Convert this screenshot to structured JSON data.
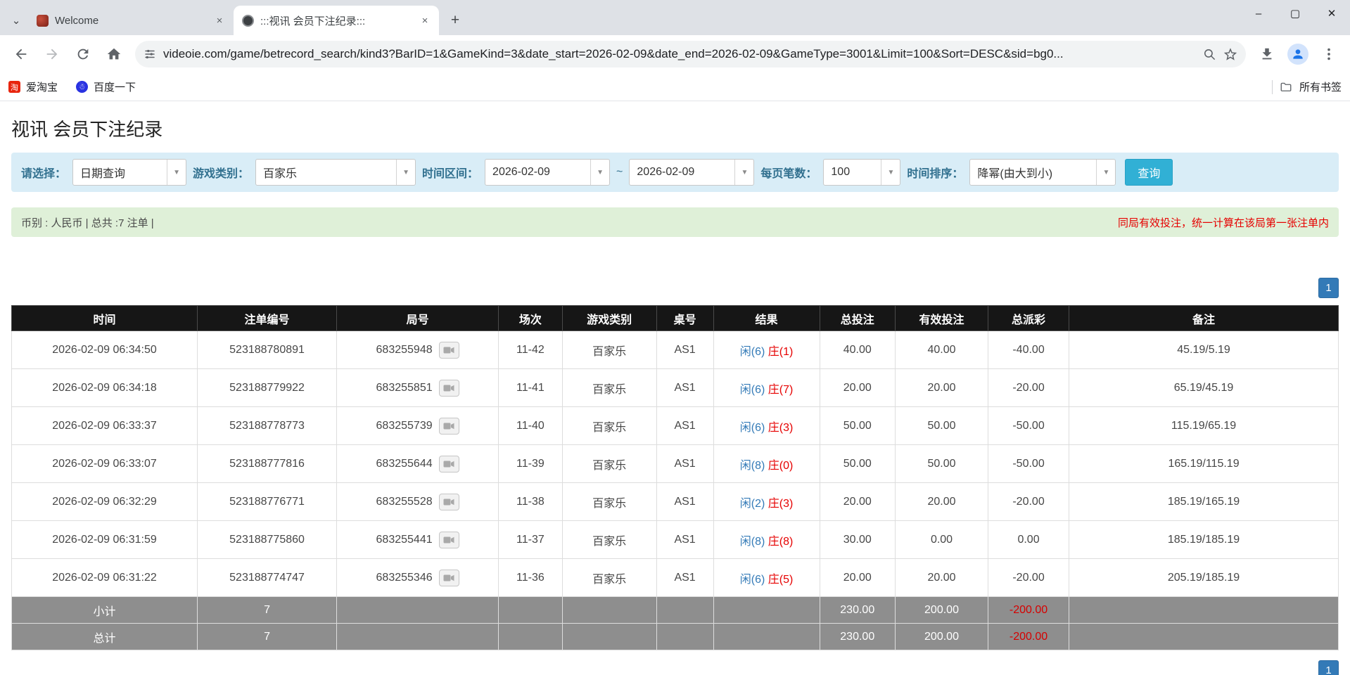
{
  "browser": {
    "tabs": [
      {
        "title": "Welcome"
      },
      {
        "title": ":::视讯 会员下注纪录:::"
      }
    ],
    "url": "videoie.com/game/betrecord_search/kind3?BarID=1&GameKind=3&date_start=2026-02-09&date_end=2026-02-09&GameType=3001&Limit=100&Sort=DESC&sid=bg0...",
    "bookmarks": [
      {
        "label": "爱淘宝"
      },
      {
        "label": "百度一下"
      }
    ],
    "all_bookmarks_label": "所有书签"
  },
  "page": {
    "title": "视讯 会员下注纪录",
    "filters": {
      "select_label": "请选择：",
      "select_value": "日期查询",
      "game_kind_label": "游戏类别：",
      "game_kind_value": "百家乐",
      "date_range_label": "时间区间：",
      "date_start": "2026-02-09",
      "tilde": "~",
      "date_end": "2026-02-09",
      "page_size_label": "每页笔数：",
      "page_size_value": "100",
      "sort_label": "时间排序：",
      "sort_value": "降幂(由大到小)",
      "search_button": "查询"
    },
    "info_bar": {
      "left": "币别 : 人民币 | 总共 :7 注单 |",
      "right": "同局有效投注，统一计算在该局第一张注单内"
    },
    "pagination": {
      "page": "1"
    },
    "table": {
      "headers": [
        "时间",
        "注单编号",
        "局号",
        "场次",
        "游戏类别",
        "桌号",
        "结果",
        "总投注",
        "有效投注",
        "总派彩",
        "备注"
      ],
      "rows": [
        {
          "time": "2026-02-09 06:34:50",
          "bet_id": "523188780891",
          "round": "683255948",
          "session": "11-42",
          "game": "百家乐",
          "table": "AS1",
          "player": "闲(6)",
          "banker": "庄(1)",
          "total": "40.00",
          "valid": "40.00",
          "payout": "-40.00",
          "note": "45.19/5.19"
        },
        {
          "time": "2026-02-09 06:34:18",
          "bet_id": "523188779922",
          "round": "683255851",
          "session": "11-41",
          "game": "百家乐",
          "table": "AS1",
          "player": "闲(6)",
          "banker": "庄(7)",
          "total": "20.00",
          "valid": "20.00",
          "payout": "-20.00",
          "note": "65.19/45.19"
        },
        {
          "time": "2026-02-09 06:33:37",
          "bet_id": "523188778773",
          "round": "683255739",
          "session": "11-40",
          "game": "百家乐",
          "table": "AS1",
          "player": "闲(6)",
          "banker": "庄(3)",
          "total": "50.00",
          "valid": "50.00",
          "payout": "-50.00",
          "note": "115.19/65.19"
        },
        {
          "time": "2026-02-09 06:33:07",
          "bet_id": "523188777816",
          "round": "683255644",
          "session": "11-39",
          "game": "百家乐",
          "table": "AS1",
          "player": "闲(8)",
          "banker": "庄(0)",
          "total": "50.00",
          "valid": "50.00",
          "payout": "-50.00",
          "note": "165.19/115.19"
        },
        {
          "time": "2026-02-09 06:32:29",
          "bet_id": "523188776771",
          "round": "683255528",
          "session": "11-38",
          "game": "百家乐",
          "table": "AS1",
          "player": "闲(2)",
          "banker": "庄(3)",
          "total": "20.00",
          "valid": "20.00",
          "payout": "-20.00",
          "note": "185.19/165.19"
        },
        {
          "time": "2026-02-09 06:31:59",
          "bet_id": "523188775860",
          "round": "683255441",
          "session": "11-37",
          "game": "百家乐",
          "table": "AS1",
          "player": "闲(8)",
          "banker": "庄(8)",
          "total": "30.00",
          "valid": "0.00",
          "payout": "0.00",
          "note": "185.19/185.19"
        },
        {
          "time": "2026-02-09 06:31:22",
          "bet_id": "523188774747",
          "round": "683255346",
          "session": "11-36",
          "game": "百家乐",
          "table": "AS1",
          "player": "闲(6)",
          "banker": "庄(5)",
          "total": "20.00",
          "valid": "20.00",
          "payout": "-20.00",
          "note": "205.19/185.19"
        }
      ],
      "subtotal": {
        "label": "小计",
        "count": "7",
        "total": "230.00",
        "valid": "200.00",
        "payout": "-200.00"
      },
      "total": {
        "label": "总计",
        "count": "7",
        "total": "230.00",
        "valid": "200.00",
        "payout": "-200.00"
      }
    }
  }
}
